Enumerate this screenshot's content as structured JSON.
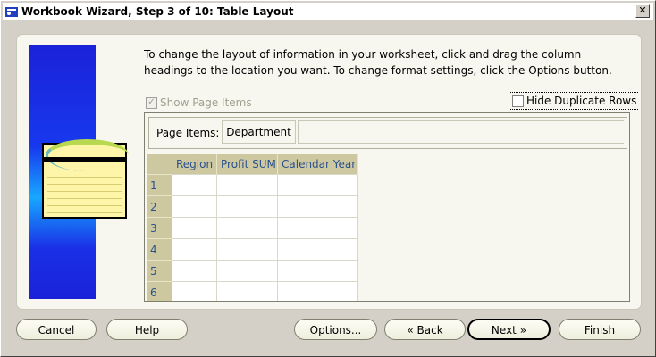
{
  "window": {
    "title": "Workbook Wizard, Step 3 of 10: Table Layout",
    "close_glyph": "✕"
  },
  "content": {
    "instructions": "To change the layout of information in your worksheet, click and drag the column headings to the location you want.  To change format settings, click the Options button.",
    "show_page_items": {
      "label": "Show Page Items",
      "checked": true,
      "enabled": false
    },
    "hide_duplicate_rows": {
      "label": "Hide Duplicate Rows",
      "checked": false
    },
    "page_items_label": "Page Items:",
    "page_item_chip": "Department",
    "columns": [
      "Region",
      "Profit SUM",
      "Calendar Year"
    ],
    "rows": [
      "1",
      "2",
      "3",
      "4",
      "5",
      "6"
    ]
  },
  "buttons": {
    "cancel": "Cancel",
    "help": "Help",
    "options": "Options...",
    "back": "Back",
    "next": "Next",
    "finish": "Finish"
  },
  "colors": {
    "header_bg": "#cdc8a0",
    "header_text": "#2a5090",
    "panel_bg": "#f7f7ef",
    "dialog_bg": "#d4d0c8"
  }
}
